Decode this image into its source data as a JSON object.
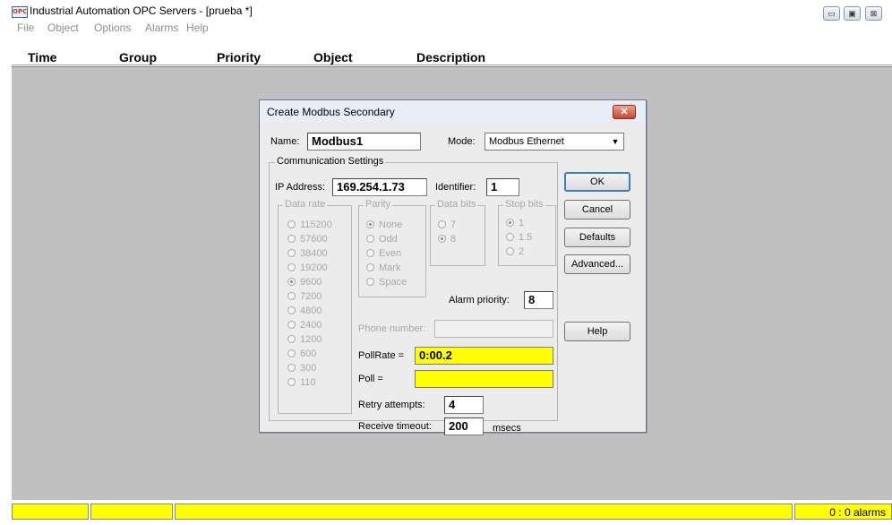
{
  "window": {
    "icon_text": "OPC",
    "title": "Industrial Automation OPC Servers - [prueba *]",
    "controls": {
      "minimize": "▭",
      "maximize": "▣",
      "close": "⊠"
    }
  },
  "menu": [
    "File",
    "Object",
    "Options",
    "Alarms",
    "Help"
  ],
  "columns": [
    "Time",
    "Group",
    "Priority",
    "Object",
    "Description"
  ],
  "status_bar": {
    "alarms": "0 : 0 alarms"
  },
  "dialog": {
    "title": "Create Modbus Secondary",
    "close_label": "✕",
    "name_label": "Name:",
    "name_value": "Modbus1",
    "mode_label": "Mode:",
    "mode_value": "Modbus Ethernet",
    "comm_group_label": "Communication Settings",
    "ip_label": "IP Address:",
    "ip_value": "169.254.1.73",
    "identifier_label": "Identifier:",
    "identifier_value": "1",
    "data_rate": {
      "label": "Data rate",
      "options": [
        "115200",
        "57600",
        "38400",
        "19200",
        "9600",
        "7200",
        "4800",
        "2400",
        "1200",
        "600",
        "300",
        "110"
      ],
      "selected": "9600"
    },
    "parity": {
      "label": "Parity",
      "options": [
        "None",
        "Odd",
        "Even",
        "Mark",
        "Space"
      ],
      "selected": "None"
    },
    "data_bits": {
      "label": "Data bits",
      "options": [
        "7",
        "8"
      ],
      "selected": "8"
    },
    "stop_bits": {
      "label": "Stop bits",
      "options": [
        "1",
        "1.5",
        "2"
      ],
      "selected": "1"
    },
    "alarm_priority_label": "Alarm priority:",
    "alarm_priority_value": "8",
    "phone_label": "Phone number:",
    "phone_value": "",
    "pollrate_label": "PollRate =",
    "pollrate_value": "0:00.2",
    "poll_label": "Poll =",
    "poll_value": "",
    "retry_label": "Retry attempts:",
    "retry_value": "4",
    "timeout_label": "Receive timeout:",
    "timeout_value": "200",
    "timeout_unit": "msecs",
    "buttons": {
      "ok": "OK",
      "cancel": "Cancel",
      "defaults": "Defaults",
      "advanced": "Advanced...",
      "help": "Help"
    }
  }
}
